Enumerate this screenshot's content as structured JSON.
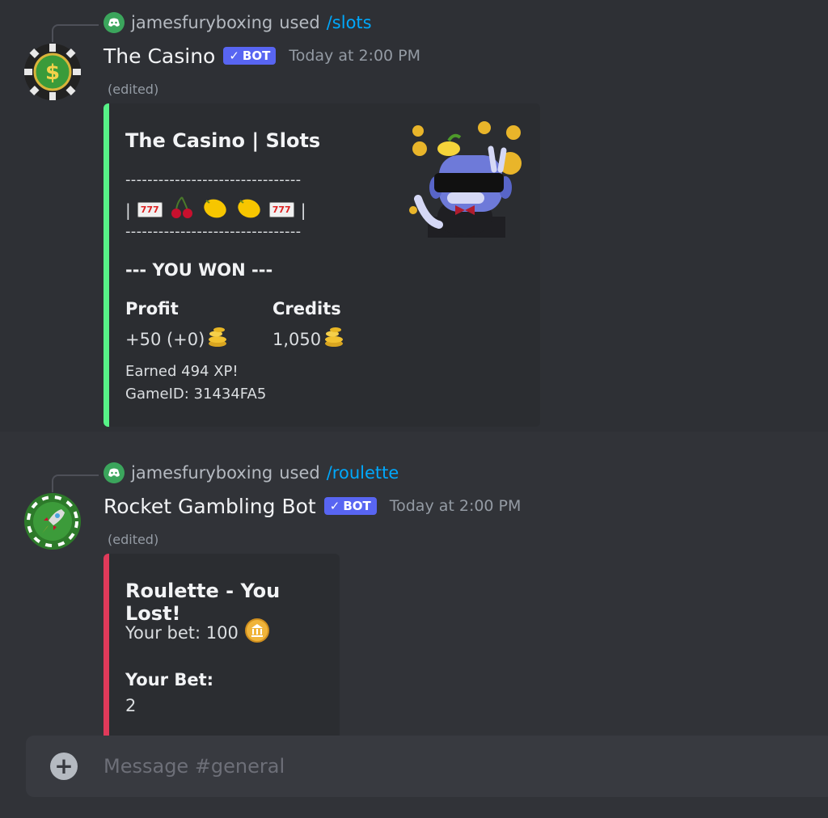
{
  "messages": [
    {
      "reply": {
        "user": "jamesfuryboxing",
        "verb": "used",
        "command": "/slots"
      },
      "author": "The Casino",
      "bot_tag": "BOT",
      "timestamp": "Today at 2:00 PM",
      "edited": "(edited)",
      "embed": {
        "accent": "#57f287",
        "title": "The Casino | Slots",
        "dashes": "--------------------------------",
        "reels_left": "|",
        "reels_right": "|",
        "seven_label": "777",
        "result": "--- YOU WON ---",
        "fields": [
          {
            "name": "Profit",
            "value": "+50 (+0)",
            "icon": "coins-icon"
          },
          {
            "name": "Credits",
            "value": "1,050",
            "icon": "coins-icon"
          }
        ],
        "footer": [
          "Earned 494 XP!",
          "GameID: 31434FA5"
        ]
      }
    },
    {
      "reply": {
        "user": "jamesfuryboxing",
        "verb": "used",
        "command": "/roulette"
      },
      "author": "Rocket Gambling Bot",
      "bot_tag": "BOT",
      "timestamp": "Today at 2:00 PM",
      "edited": "(edited)",
      "embed": {
        "accent": "#e03a5a",
        "title": "Roulette - You Lost!",
        "bet_line": "Your bet: 100",
        "field_name": "Your Bet:",
        "field_value": "2"
      }
    }
  ],
  "input": {
    "placeholder": "Message #general"
  }
}
